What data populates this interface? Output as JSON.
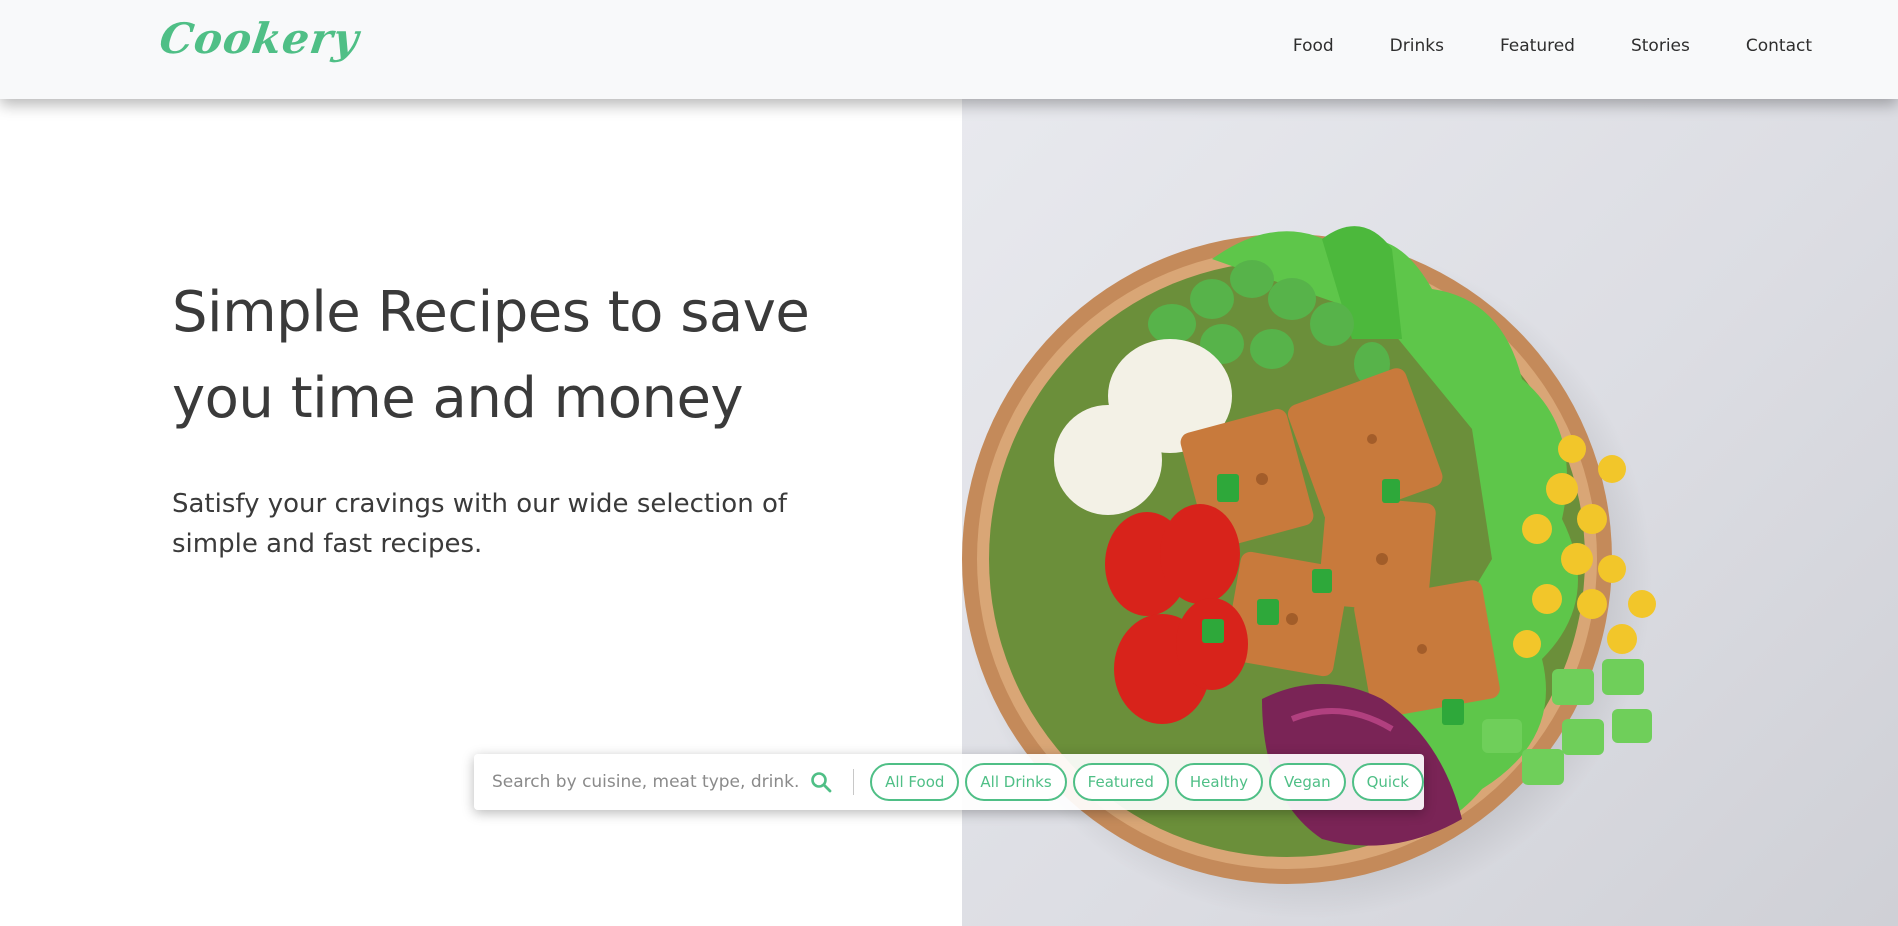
{
  "header": {
    "logo": "Cookery",
    "nav": [
      {
        "label": "Food"
      },
      {
        "label": "Drinks"
      },
      {
        "label": "Featured"
      },
      {
        "label": "Stories"
      },
      {
        "label": "Contact"
      }
    ]
  },
  "hero": {
    "title_line1": "Simple Recipes to save",
    "title_line2": "you time and money",
    "subtitle_line1": "Satisfy your cravings with our wide selection of",
    "subtitle_line2": "simple and fast recipes."
  },
  "search": {
    "placeholder": "Search by cuisine, meat type, drink...",
    "icon": "search-icon",
    "chips": [
      {
        "label": "All Food"
      },
      {
        "label": "All Drinks"
      },
      {
        "label": "Featured"
      },
      {
        "label": "Healthy"
      },
      {
        "label": "Vegan"
      },
      {
        "label": "Quick"
      }
    ]
  },
  "colors": {
    "accent": "#4fbf86",
    "text": "#3a3a3a",
    "header_bg": "#f8f9fa"
  }
}
